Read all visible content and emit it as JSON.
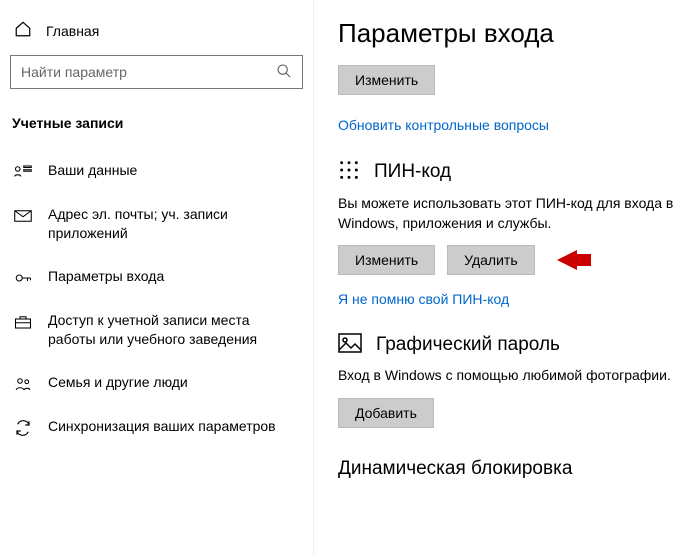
{
  "sidebar": {
    "home_label": "Главная",
    "search_placeholder": "Найти параметр",
    "section_title": "Учетные записи",
    "items": [
      {
        "label": "Ваши данные"
      },
      {
        "label": "Адрес эл. почты; уч. записи приложений"
      },
      {
        "label": "Параметры входа"
      },
      {
        "label": "Доступ к учетной записи места работы или учебного заведения"
      },
      {
        "label": "Семья и другие люди"
      },
      {
        "label": "Синхронизация ваших параметров"
      }
    ]
  },
  "main": {
    "title": "Параметры входа",
    "change_top_button": "Изменить",
    "update_questions_link": "Обновить контрольные вопросы",
    "pin": {
      "heading": "ПИН-код",
      "desc": "Вы можете использовать этот ПИН-код для входа в Windows, приложения и службы.",
      "change_button": "Изменить",
      "delete_button": "Удалить",
      "forgot_link": "Я не помню свой ПИН-код"
    },
    "picture": {
      "heading": "Графический пароль",
      "desc": "Вход в Windows с помощью любимой фотографии.",
      "add_button": "Добавить"
    },
    "dynamic_lock_heading": "Динамическая блокировка"
  }
}
